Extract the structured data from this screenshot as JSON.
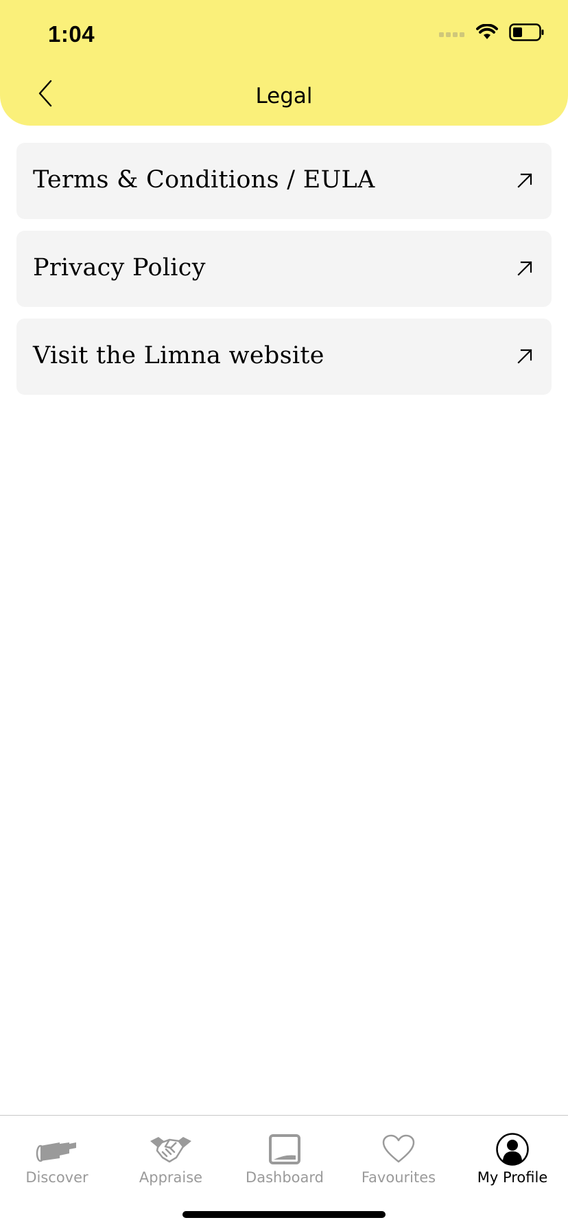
{
  "status_bar": {
    "time": "1:04"
  },
  "nav": {
    "title": "Legal"
  },
  "items": [
    {
      "label": "Terms & Conditions / EULA"
    },
    {
      "label": "Privacy Policy"
    },
    {
      "label": "Visit the Limna website"
    }
  ],
  "tabs": [
    {
      "label": "Discover",
      "icon": "telescope-icon",
      "active": false
    },
    {
      "label": "Appraise",
      "icon": "handshake-icon",
      "active": false
    },
    {
      "label": "Dashboard",
      "icon": "laptop-icon",
      "active": false
    },
    {
      "label": "Favourites",
      "icon": "heart-icon",
      "active": false
    },
    {
      "label": "My Profile",
      "icon": "profile-icon",
      "active": true
    }
  ],
  "colors": {
    "header_bg": "#FAF07A",
    "row_bg": "#F4F4F4",
    "tab_inactive": "#9A9A9A",
    "tab_active": "#000000"
  }
}
